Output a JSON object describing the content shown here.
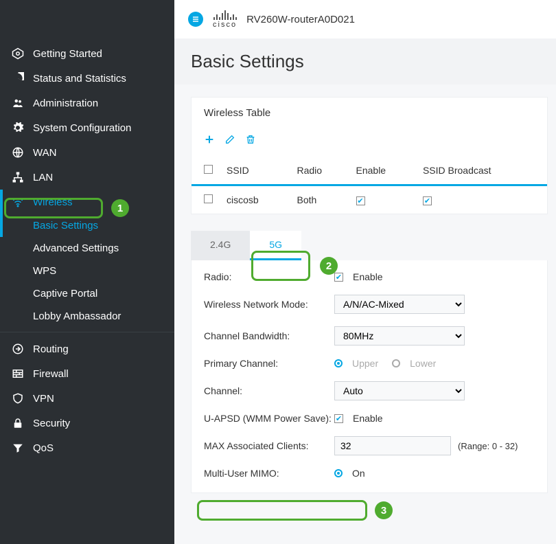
{
  "header": {
    "ciscoText": "cisco",
    "deviceName": "RV260W-routerA0D021"
  },
  "sidebar": {
    "items": [
      {
        "label": "Getting Started",
        "icon": "gear"
      },
      {
        "label": "Status and Statistics",
        "icon": "pie"
      },
      {
        "label": "Administration",
        "icon": "users"
      },
      {
        "label": "System Configuration",
        "icon": "cog"
      },
      {
        "label": "WAN",
        "icon": "globe"
      },
      {
        "label": "LAN",
        "icon": "lan"
      },
      {
        "label": "Wireless",
        "icon": "wifi",
        "active": true,
        "sub": [
          {
            "label": "Basic Settings",
            "active": true
          },
          {
            "label": "Advanced Settings"
          },
          {
            "label": "WPS"
          },
          {
            "label": "Captive Portal"
          },
          {
            "label": "Lobby Ambassador"
          }
        ]
      },
      {
        "label": "Routing",
        "icon": "route"
      },
      {
        "label": "Firewall",
        "icon": "firewall"
      },
      {
        "label": "VPN",
        "icon": "shield"
      },
      {
        "label": "Security",
        "icon": "lock"
      },
      {
        "label": "QoS",
        "icon": "filter"
      }
    ]
  },
  "page": {
    "title": "Basic Settings"
  },
  "wirelessTable": {
    "title": "Wireless Table",
    "headers": {
      "ssid": "SSID",
      "radio": "Radio",
      "enable": "Enable",
      "broadcast": "SSID Broadcast"
    },
    "rows": [
      {
        "ssid": "ciscosb",
        "radio": "Both",
        "enable": true,
        "broadcast": true
      }
    ]
  },
  "tabs": {
    "tab24": "2.4G",
    "tab5": "5G",
    "active": "5G"
  },
  "form": {
    "radioLabel": "Radio:",
    "radioEnable": "Enable",
    "radioChecked": true,
    "modeLabel": "Wireless Network Mode:",
    "modeValue": "A/N/AC-Mixed",
    "bwLabel": "Channel Bandwidth:",
    "bwValue": "80MHz",
    "primaryLabel": "Primary Channel:",
    "primaryUpper": "Upper",
    "primaryLower": "Lower",
    "primarySelected": "Upper",
    "channelLabel": "Channel:",
    "channelValue": "Auto",
    "uapsdLabel": "U-APSD (WMM Power Save):",
    "uapsdEnable": "Enable",
    "uapsdChecked": true,
    "maxLabel": "MAX Associated Clients:",
    "maxValue": "32",
    "maxRange": "(Range: 0 - 32)",
    "mimoLabel": "Multi-User MIMO:",
    "mimoOn": "On",
    "mimoSelected": "On"
  },
  "annotations": {
    "one": "1",
    "two": "2",
    "three": "3"
  }
}
